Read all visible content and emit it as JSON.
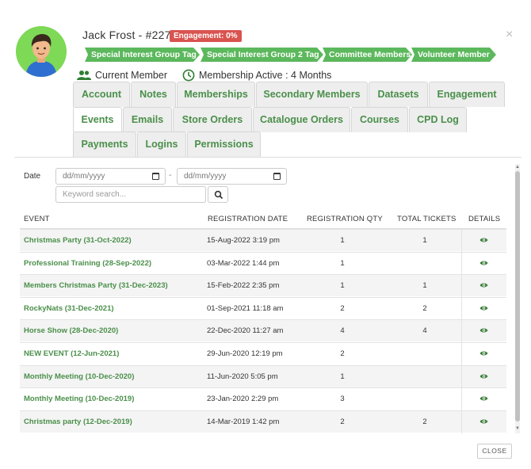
{
  "header": {
    "close_glyph": "×",
    "name": "Jack Frost - #2277",
    "engagement_badge": "Engagement: 0%",
    "tags": [
      "Special Interest Group Tag",
      "Special Interest Group 2 Tag",
      "Committee Members",
      "Volunteer Member"
    ],
    "member_status": "Current Member",
    "membership_status": "Membership Active : 4 Months",
    "accent_color": "#5cb85c",
    "badge_color": "#d9534f"
  },
  "tabs": [
    "Account",
    "Notes",
    "Memberships",
    "Secondary Members",
    "Datasets",
    "Engagement",
    "Events",
    "Emails",
    "Store Orders",
    "Catalogue Orders",
    "Courses",
    "CPD Log",
    "Payments",
    "Logins",
    "Permissions"
  ],
  "active_tab": "Events",
  "filters": {
    "date_label": "Date",
    "from_placeholder": "dd/mm/yyyy",
    "date_separator": "-",
    "to_placeholder": "dd/mm/yyyy",
    "keyword_placeholder": "Keyword search..."
  },
  "table": {
    "headers": [
      "EVENT",
      "REGISTRATION DATE",
      "REGISTRATION QTY",
      "TOTAL TICKETS",
      "DETAILS"
    ],
    "rows": [
      {
        "event": "Christmas Party (31-Oct-2022)",
        "date": "15-Aug-2022 3:19 pm",
        "qty": "1",
        "tickets": "1"
      },
      {
        "event": "Professional Training (28-Sep-2022)",
        "date": "03-Mar-2022 1:44 pm",
        "qty": "1",
        "tickets": ""
      },
      {
        "event": "Members Christmas Party (31-Dec-2023)",
        "date": "15-Feb-2022 2:35 pm",
        "qty": "1",
        "tickets": "1"
      },
      {
        "event": "RockyNats (31-Dec-2021)",
        "date": "01-Sep-2021 11:18 am",
        "qty": "2",
        "tickets": "2"
      },
      {
        "event": "Horse Show (28-Dec-2020)",
        "date": "22-Dec-2020 11:27 am",
        "qty": "4",
        "tickets": "4"
      },
      {
        "event": "NEW EVENT (12-Jun-2021)",
        "date": "29-Jun-2020 12:19 pm",
        "qty": "2",
        "tickets": ""
      },
      {
        "event": "Monthly Meeting (10-Dec-2020)",
        "date": "11-Jun-2020 5:05 pm",
        "qty": "1",
        "tickets": ""
      },
      {
        "event": "Monthly Meeting (10-Dec-2019)",
        "date": "23-Jan-2020 2:29 pm",
        "qty": "3",
        "tickets": ""
      },
      {
        "event": "Christmas party (12-Dec-2019)",
        "date": "14-Mar-2019 1:42 pm",
        "qty": "2",
        "tickets": "2"
      }
    ],
    "details_icon": "eye-icon"
  },
  "footer": {
    "close_label": "CLOSE"
  }
}
